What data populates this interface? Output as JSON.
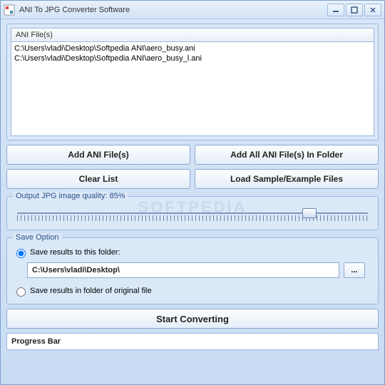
{
  "window": {
    "title": "ANI To JPG Converter Software"
  },
  "fileList": {
    "header": "ANI File(s)",
    "items": [
      "C:\\Users\\vladi\\Desktop\\Softpedia ANI\\aero_busy.ani",
      "C:\\Users\\vladi\\Desktop\\Softpedia ANI\\aero_busy_l.ani"
    ]
  },
  "buttons": {
    "addFiles": "Add ANI File(s)",
    "addFolder": "Add All ANI File(s) In Folder",
    "clearList": "Clear List",
    "loadSample": "Load Sample/Example Files",
    "start": "Start Converting",
    "browse": "..."
  },
  "quality": {
    "labelPrefix": "Output JPG image quality: ",
    "value": 85,
    "labelSuffix": "%"
  },
  "saveOption": {
    "legend": "Save Option",
    "radioFolder": "Save results to this folder:",
    "radioOriginal": "Save results in folder of original file",
    "path": "C:\\Users\\vladi\\Desktop\\",
    "selected": "folder"
  },
  "progress": {
    "label": "Progress Bar"
  },
  "watermark": "SOFTPEDIA"
}
